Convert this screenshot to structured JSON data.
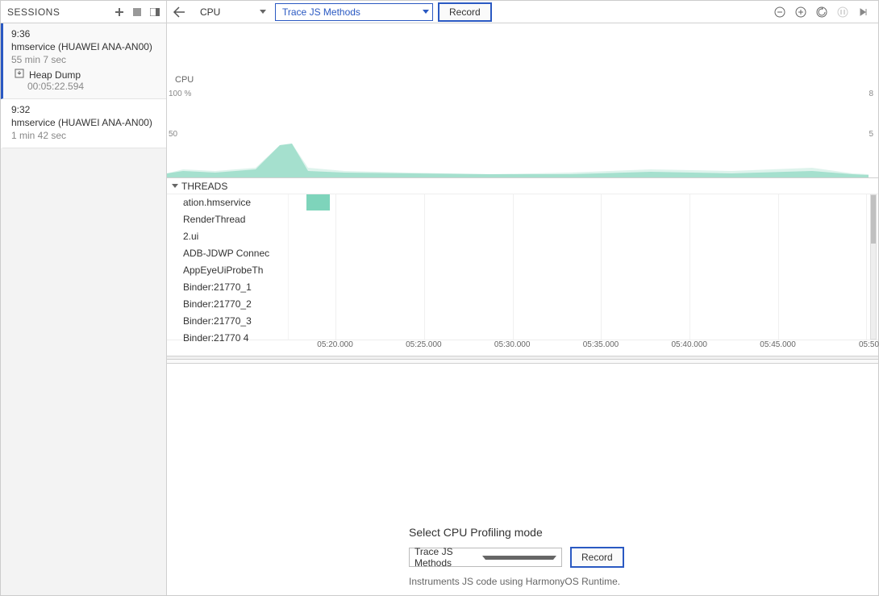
{
  "sessions": {
    "title": "SESSIONS",
    "items": [
      {
        "time": "9:36",
        "name": "hmservice (HUAWEI ANA-AN00)",
        "duration": "55 min 7 sec",
        "dump_label": "Heap Dump",
        "dump_ts": "00:05:22.594"
      },
      {
        "time": "9:32",
        "name": "hmservice (HUAWEI ANA-AN00)",
        "duration": "1 min 42 sec"
      }
    ]
  },
  "toolbar": {
    "profiler_combo": "CPU",
    "trace_combo": "Trace JS Methods",
    "record_label": "Record"
  },
  "cpu": {
    "label": "CPU",
    "axis_left": [
      "100 %",
      "50"
    ],
    "axis_right": [
      "8",
      "5"
    ]
  },
  "threads": {
    "header": "THREADS",
    "rows": [
      "ation.hmservice",
      "RenderThread",
      "2.ui",
      "ADB-JDWP Connec",
      "AppEyeUiProbeTh",
      "Binder:21770_1",
      "Binder:21770_2",
      "Binder:21770_3",
      "Binder:21770 4"
    ]
  },
  "timeline": {
    "ticks": [
      "05:20.000",
      "05:25.000",
      "05:30.000",
      "05:35.000",
      "05:40.000",
      "05:45.000",
      "05:50.0"
    ]
  },
  "details": {
    "title": "Select CPU Profiling mode",
    "combo": "Trace JS Methods",
    "record": "Record",
    "desc": "Instruments JS code using HarmonyOS Runtime."
  },
  "chart_data": {
    "type": "area",
    "title": "CPU",
    "ylabel": "CPU %",
    "ylim": [
      0,
      100
    ],
    "ylabel_right": "threads",
    "ylim_right": [
      0,
      8
    ],
    "x_unit": "mm:ss.SSS",
    "x_range": [
      "05:19.000",
      "05:50.000"
    ],
    "series": [
      {
        "name": "cpu_percent",
        "x": [
          "05:19.0",
          "05:20.5",
          "05:21.0",
          "05:22.5",
          "05:23.5",
          "05:24.0",
          "05:25.5",
          "05:27.0",
          "05:29.0",
          "05:31.0",
          "05:34.0",
          "05:37.0",
          "05:40.0",
          "05:43.0",
          "05:46.0",
          "05:49.0",
          "05:50.0"
        ],
        "values": [
          5,
          8,
          6,
          10,
          40,
          42,
          8,
          6,
          5,
          4,
          3,
          4,
          7,
          5,
          8,
          4,
          3
        ]
      }
    ]
  }
}
